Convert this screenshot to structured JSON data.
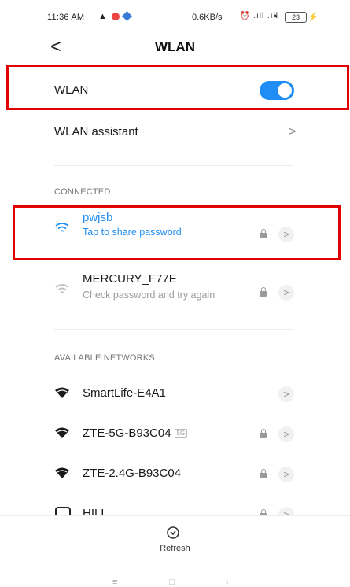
{
  "status": {
    "time": "11:36 AM",
    "warn": "▲",
    "speed": "0.6KB/s",
    "signal": "᷊⏰ ᵃˡˡ ᵃˡˡ",
    "battery": "23",
    "bolt": "⚡"
  },
  "header": {
    "back": "<",
    "title": "WLAN"
  },
  "wlan_row": {
    "label": "WLAN",
    "toggle_on": true,
    "toggle_color": "#1f8df3"
  },
  "assistant_row": {
    "label": "WLAN assistant",
    "chevron": ">"
  },
  "connected": {
    "header": "CONNECTED",
    "networks": [
      {
        "name": "pwjsb",
        "sub": "Tap to share password",
        "accent": "#1f8df3"
      },
      {
        "name": "MERCURY_F77E",
        "sub": "Check password and try again"
      }
    ]
  },
  "available": {
    "header": "AVAILABLE NETWORKS",
    "networks": [
      {
        "name": "SmartLife-E4A1",
        "locked": false
      },
      {
        "name": "ZTE-5G-B93C04",
        "badge": "5G",
        "locked": true
      },
      {
        "name": "ZTE-2.4G-B93C04",
        "locked": true
      },
      {
        "name": "HILL",
        "locked": true
      }
    ]
  },
  "arrow": ">",
  "bottom": {
    "refresh_label": "Refresh"
  },
  "navbar": {
    "menu": "≡",
    "home": "□",
    "back": "‹"
  }
}
